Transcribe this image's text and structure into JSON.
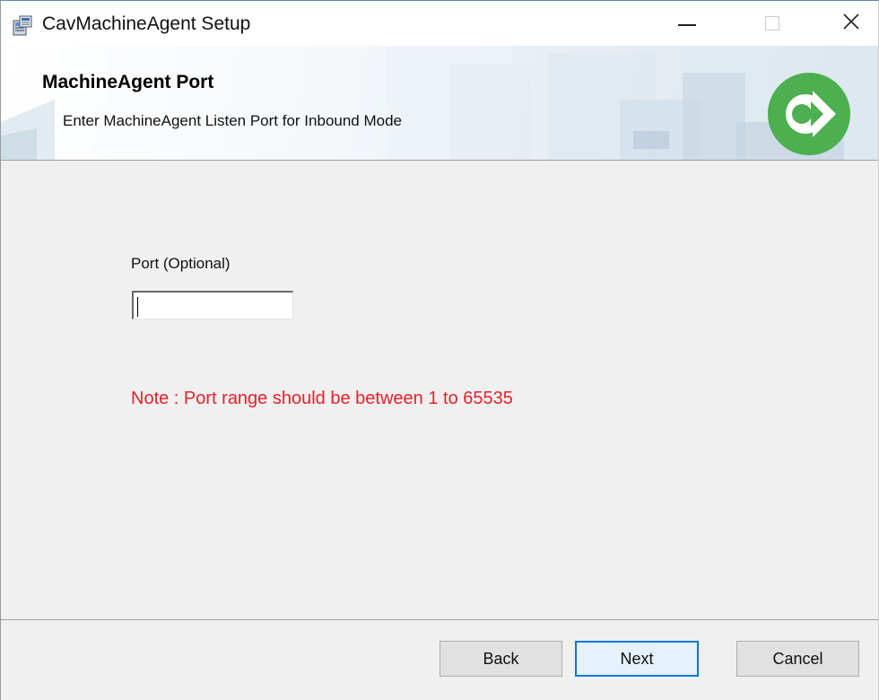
{
  "window": {
    "title": "CavMachineAgent Setup",
    "icons": {
      "app": "installer-icon",
      "minimize": "minimize-icon",
      "maximize": "maximize-icon",
      "close": "close-icon"
    },
    "close_glyph": "✕"
  },
  "banner": {
    "title": "MachineAgent Port",
    "subtitle": "Enter MachineAgent Listen Port for Inbound Mode",
    "logo_icon": "green-arrow-logo-icon",
    "logo_color": "#4caf50"
  },
  "form": {
    "port_label": "Port (Optional)",
    "port_value": "",
    "note": "Note : Port range should be between 1 to 65535",
    "note_color": "#e8202a"
  },
  "buttons": {
    "back": "Back",
    "next": "Next",
    "cancel": "Cancel"
  },
  "colors": {
    "focus_accent": "#0078d7",
    "dialog_background": "#f0f0f0"
  }
}
